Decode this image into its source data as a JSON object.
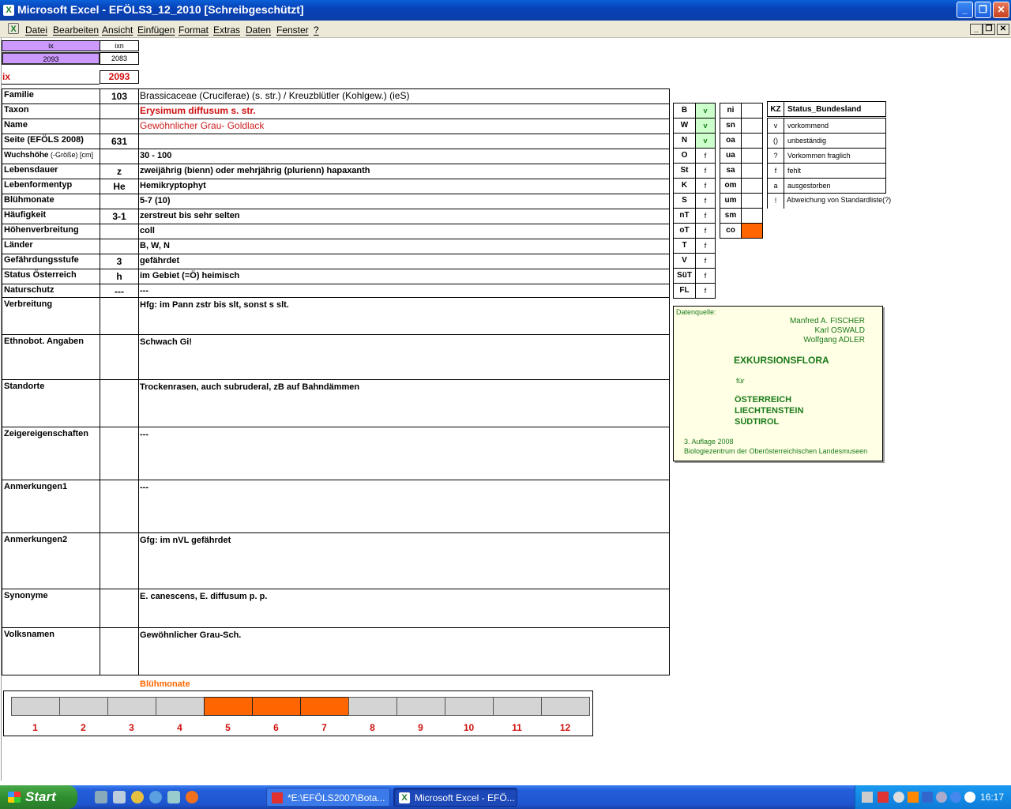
{
  "window": {
    "title": "Microsoft Excel - EFÖLS3_12_2010  [Schreibgeschützt]",
    "btn_min": "_",
    "btn_max": "❐",
    "btn_close": "✕",
    "doc_min": "_",
    "doc_max": "❐",
    "doc_close": "✕"
  },
  "menu": {
    "file": "Datei",
    "edit": "Bearbeiten",
    "view": "Ansicht",
    "insert": "Einfügen",
    "format": "Format",
    "extras": "Extras",
    "data": "Daten",
    "window": "Fenster",
    "help": "?"
  },
  "top": {
    "ix_head": "ix",
    "ixn_head": "ixn",
    "ix_val": "2093",
    "ixn_val": "2083",
    "ix_label": "ix",
    "ix_big": "2093"
  },
  "rows": {
    "familie": {
      "label": "Familie",
      "code": "103",
      "value": "Brassicaceae (Cruciferae) (s. str.)  /  Kreuzblütler (Kohlgew.) (ieS)"
    },
    "taxon": {
      "label": "Taxon",
      "code": "",
      "value": "Erysimum diffusum s. str."
    },
    "name": {
      "label": "Name",
      "code": "",
      "value": "Gewöhnlicher Grau- Goldlack"
    },
    "seite": {
      "label": "Seite (EFÖLS 2008)",
      "code": "631",
      "value": ""
    },
    "wuchs": {
      "label": "Wuchshöhe",
      "label_small": " (-Größe) [cm]",
      "code": "",
      "value": "30 - 100"
    },
    "lebensdauer": {
      "label": "Lebensdauer",
      "code": "z",
      "value": "zweijährig (bienn) oder mehrjährig (plurienn) hapaxanth"
    },
    "lebensform": {
      "label": "Lebenformentyp",
      "code": "He",
      "value": "Hemikryptophyt"
    },
    "bluehmonate": {
      "label": "Blühmonate",
      "code": "",
      "value": "5-7 (10)"
    },
    "haeufigkeit": {
      "label": "Häufigkeit",
      "code": "3-1",
      "value": "zerstreut bis sehr selten"
    },
    "hoehe": {
      "label": "Höhenverbreitung",
      "code": "",
      "value": "coll"
    },
    "laender": {
      "label": "Länder",
      "code": "",
      "value": "B, W, N"
    },
    "gefaehrdung": {
      "label": "Gefährdungsstufe",
      "code": "3",
      "value": "gefährdet"
    },
    "status": {
      "label": "Status Österreich",
      "code": "h",
      "value": "im Gebiet (=Ö) heimisch"
    },
    "naturschutz": {
      "label": "Naturschutz",
      "code": "---",
      "value": "---"
    },
    "verbreitung": {
      "label": "Verbreitung",
      "value": "Hfg: im Pann zstr bis slt, sonst s slt."
    },
    "ethnobot": {
      "label": "Ethnobot. Angaben",
      "value": "Schwach Gi!"
    },
    "standorte": {
      "label": "Standorte",
      "value": "Trockenrasen, auch subruderal, zB auf Bahndämmen"
    },
    "zeiger": {
      "label": "Zeigereigenschaften",
      "value": "---"
    },
    "anm1": {
      "label": "Anmerkungen1",
      "value": "---"
    },
    "anm2": {
      "label": "Anmerkungen2",
      "value": "Gfg:  im nVL gefährdet"
    },
    "synonyme": {
      "label": "Synonyme",
      "value": "E. canescens, E. diffusum p. p."
    },
    "volksnamen": {
      "label": "Volksnamen",
      "value": "Gewöhnlicher Grau-Sch."
    }
  },
  "states": [
    {
      "code": "B",
      "val": "v",
      "hl": true
    },
    {
      "code": "W",
      "val": "v",
      "hl": true
    },
    {
      "code": "N",
      "val": "v",
      "hl": true
    },
    {
      "code": "O",
      "val": "f",
      "hl": false
    },
    {
      "code": "St",
      "val": "f",
      "hl": false
    },
    {
      "code": "K",
      "val": "f",
      "hl": false
    },
    {
      "code": "S",
      "val": "f",
      "hl": false
    },
    {
      "code": "nT",
      "val": "f",
      "hl": false
    },
    {
      "code": "oT",
      "val": "f",
      "hl": false
    },
    {
      "code": "T",
      "val": "f",
      "hl": false
    },
    {
      "code": "V",
      "val": "f",
      "hl": false
    },
    {
      "code": "SüT",
      "val": "f",
      "hl": false
    },
    {
      "code": "FL",
      "val": "f",
      "hl": false
    }
  ],
  "heights": [
    "ni",
    "sn",
    "oa",
    "ua",
    "sa",
    "om",
    "um",
    "sm",
    "co"
  ],
  "height_highlight_color": "#ff6600",
  "legend": {
    "header_kz": "KZ",
    "header_status": "Status_Bundesland",
    "items": [
      {
        "kz": "v",
        "text": "vorkommend"
      },
      {
        "kz": "()",
        "text": "unbeständig"
      },
      {
        "kz": "?",
        "text": "Vorkommen fraglich"
      },
      {
        "kz": "f",
        "text": "fehlt"
      },
      {
        "kz": "a",
        "text": "ausgestorben"
      },
      {
        "kz": "!",
        "text": "Abweichung von Standardliste(?)"
      }
    ]
  },
  "source": {
    "label": "Datenquelle:",
    "author1": "Manfred A. FISCHER",
    "author2": "Karl OSWALD",
    "author3": "Wolfgang ADLER",
    "title": "EXKURSIONSFLORA",
    "fuer": "für",
    "c1": "ÖSTERREICH",
    "c2": "LIECHTENSTEIN",
    "c3": "SÜDTIROL",
    "edition": "3. Auflage 2008",
    "publisher": "Biologiezentrum der Oberösterreichischen Landesmuseen"
  },
  "bloom": {
    "title": "Blühmonate",
    "months": [
      "1",
      "2",
      "3",
      "4",
      "5",
      "6",
      "7",
      "8",
      "9",
      "10",
      "11",
      "12"
    ],
    "active": [
      5,
      6,
      7
    ],
    "active_color": "#ff6600"
  },
  "taskbar": {
    "start": "Start",
    "task1": "*E:\\EFÖLS2007\\Bota...",
    "task2": "Microsoft Excel - EFÖ...",
    "clock": "16:17"
  }
}
